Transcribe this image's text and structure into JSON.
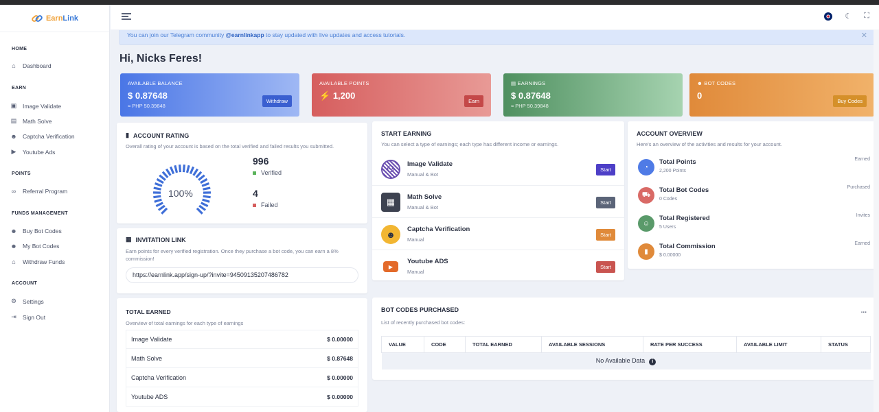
{
  "brand": {
    "name_part1": "Earn",
    "name_part2": "Link"
  },
  "sidebar": {
    "sections": [
      {
        "label": "HOME",
        "items": [
          {
            "label": "Dashboard",
            "icon": "home-icon"
          }
        ]
      },
      {
        "label": "EARN",
        "items": [
          {
            "label": "Image Validate",
            "icon": "image-icon"
          },
          {
            "label": "Math Solve",
            "icon": "calculator-icon"
          },
          {
            "label": "Captcha Verification",
            "icon": "robot-icon"
          },
          {
            "label": "Youtube Ads",
            "icon": "youtube-icon"
          }
        ]
      },
      {
        "label": "POINTS",
        "items": [
          {
            "label": "Referral Program",
            "icon": "link-icon"
          }
        ]
      },
      {
        "label": "FUNDS MANAGEMENT",
        "items": [
          {
            "label": "Buy Bot Codes",
            "icon": "robot-icon"
          },
          {
            "label": "My Bot Codes",
            "icon": "robot-icon"
          },
          {
            "label": "Withdraw Funds",
            "icon": "bank-icon"
          }
        ]
      },
      {
        "label": "ACCOUNT",
        "items": [
          {
            "label": "Settings",
            "icon": "gear-icon"
          },
          {
            "label": "Sign Out",
            "icon": "sign-out-icon"
          }
        ]
      }
    ]
  },
  "alert": {
    "prefix": "You can join our Telegram community ",
    "handle": "@earnlinkapp",
    "suffix": " to stay updated with live updates and access tutorials."
  },
  "greeting": "Hi, Nicks Feres!",
  "stats": [
    {
      "label": "AVAILABLE BALANCE",
      "value": "$ 0.87648",
      "sub": "≈ PHP 50.39848",
      "button": "Withdraw",
      "color": "#4f7be6"
    },
    {
      "label": "AVAILABLE POINTS",
      "value": "1,200",
      "sub": "",
      "button": "Earn",
      "color": "#d96a66"
    },
    {
      "label": "EARNINGS",
      "value": "$ 0.87648",
      "sub": "≈ PHP 50.39848",
      "button": "",
      "color": "#5a9a6a"
    },
    {
      "label": "BOT CODES",
      "value": "0",
      "sub": "",
      "button": "Buy Codes",
      "color": "#e08a3a"
    }
  ],
  "rating": {
    "title": "ACCOUNT RATING",
    "desc": "Overall rating of your account is based on the total verified and failed results you submitted.",
    "percent": "100%",
    "percent_value": 100,
    "verified_count": "996",
    "verified_label": "Verified",
    "failed_count": "4",
    "failed_label": "Failed"
  },
  "invite": {
    "title": "INVITATION LINK",
    "desc": "Earn points for every verified registration. Once they purchase a bot code, you can earn a 8% commission!",
    "link": "https://earnlink.app/sign-up/?invite=94509135207486782"
  },
  "total_earned": {
    "title": "TOTAL EARNED",
    "desc": "Overview of total earnings for each type of earnings",
    "rows": [
      {
        "name": "Image Validate",
        "amount": "$ 0.00000"
      },
      {
        "name": "Math Solve",
        "amount": "$ 0.87648"
      },
      {
        "name": "Captcha Verification",
        "amount": "$ 0.00000"
      },
      {
        "name": "Youtube ADS",
        "amount": "$ 0.00000"
      }
    ]
  },
  "start_earning": {
    "title": "START EARNING",
    "desc": "You can select a type of earnings; each type has different income or earnings.",
    "button_label": "Start",
    "items": [
      {
        "name": "Image Validate",
        "type": "Manual & Bot",
        "icon": "captcha-image-icon",
        "btn_color": "#4d3fc7"
      },
      {
        "name": "Math Solve",
        "type": "Manual & Bot",
        "icon": "calculator-icon",
        "btn_color": "#5b6478"
      },
      {
        "name": "Captcha Verification",
        "type": "Manual",
        "icon": "robot-face-icon",
        "btn_color": "#e08a3a"
      },
      {
        "name": "Youtube ADS",
        "type": "Manual",
        "icon": "youtube-icon",
        "btn_color": "#c95450"
      }
    ]
  },
  "overview": {
    "title": "ACCOUNT OVERVIEW",
    "desc": "Here's an overview of the activities and results for your account.",
    "items": [
      {
        "title": "Total Points",
        "sub": "2,200 Points",
        "right": "Earned",
        "color": "#4f7be6",
        "icon": "pie-chart-icon"
      },
      {
        "title": "Total Bot Codes",
        "sub": "0 Codes",
        "right": "Purchased",
        "color": "#d96a66",
        "icon": "cart-icon"
      },
      {
        "title": "Total Registered",
        "sub": "5 Users",
        "right": "Invites",
        "color": "#5a9a6a",
        "icon": "users-icon"
      },
      {
        "title": "Total Commission",
        "sub": "$ 0.00000",
        "right": "Earned",
        "color": "#e08a3a",
        "icon": "bar-chart-icon"
      }
    ]
  },
  "bot_codes": {
    "title": "BOT CODES PURCHASED",
    "desc": "List of recently purchased bot codes:",
    "menu": "...",
    "columns": [
      "VALUE",
      "CODE",
      "TOTAL EARNED",
      "AVAILABLE SESSIONS",
      "RATE PER SUCCESS",
      "AVAILABLE LIMIT",
      "STATUS"
    ],
    "empty": "No Available Data"
  }
}
